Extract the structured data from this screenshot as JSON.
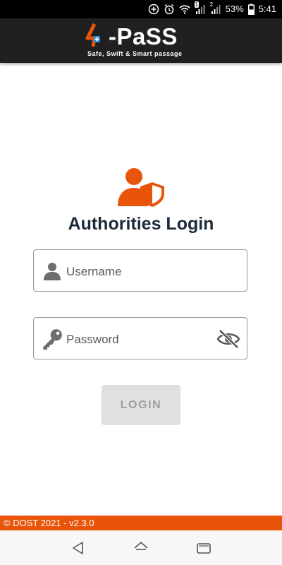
{
  "status_bar": {
    "battery": "53%",
    "time": "5:41",
    "sim1_label": "1",
    "sim2_label": "2",
    "icons": [
      "add-circle-icon",
      "alarm-icon",
      "wifi-icon",
      "signal-icon",
      "signal-icon"
    ]
  },
  "app_bar": {
    "logo_text": "-PaSS",
    "tagline": "Safe, Swift & Smart passage"
  },
  "login": {
    "title": "Authorities Login",
    "username_placeholder": "Username",
    "username_value": "",
    "password_placeholder": "Password",
    "password_value": "",
    "button_label": "LOGIN"
  },
  "footer": {
    "text": "© DOST 2021 - v2.3.0"
  },
  "colors": {
    "brand_orange": "#e8550a",
    "title_navy": "#1c2b3a",
    "header_bg": "#202020"
  }
}
